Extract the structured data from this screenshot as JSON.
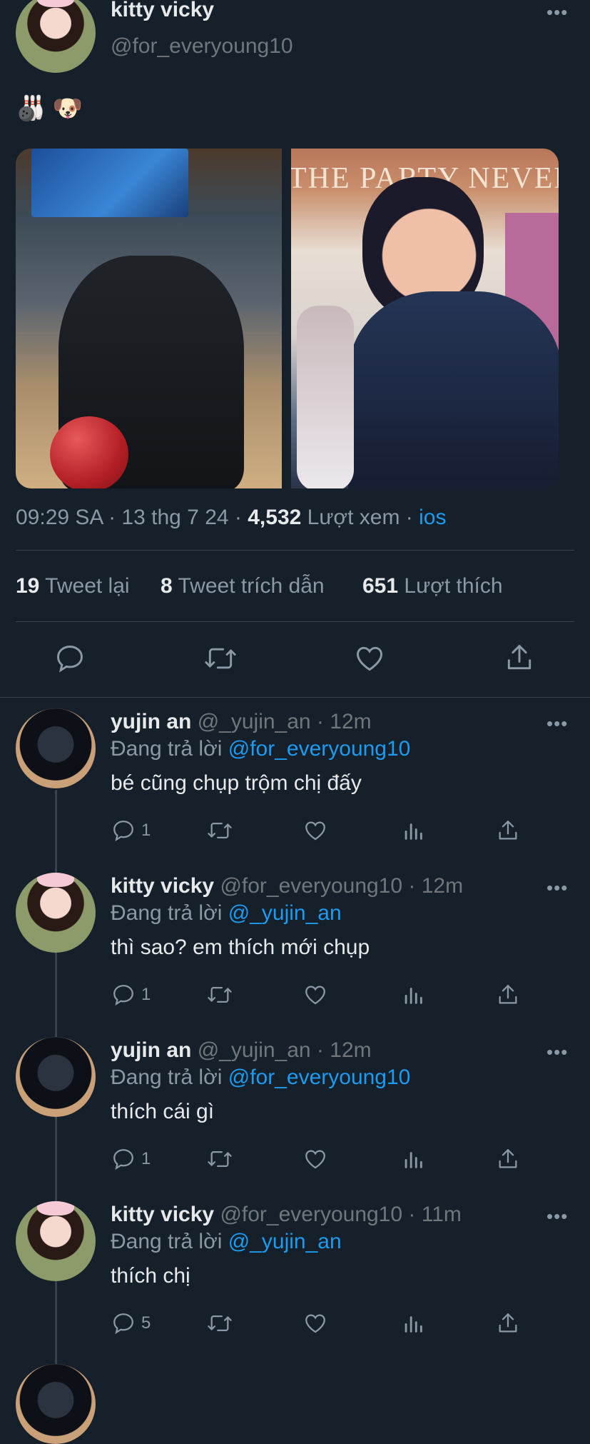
{
  "main_tweet": {
    "author_name": "kitty vicky",
    "author_handle": "@for_everyoung10",
    "text": "🎳 🐶",
    "timestamp": "09:29 SA · 13 thg 7 24 · ",
    "views_count": "4,532",
    "views_label": " Lượt xem · ",
    "source": "ios",
    "retweets_count": "19",
    "retweets_label": "Tweet lại",
    "quotes_count": "8",
    "quotes_label": "Tweet trích dẫn",
    "likes_count": "651",
    "likes_label": "Lượt thích",
    "image_left_sign": "THE PARTY NEVER EN"
  },
  "replies": [
    {
      "name": "yujin an",
      "handle": "@_yujin_an · 12m",
      "replying_prefix": "Đang trả lời ",
      "replying_to": "@for_everyoung10",
      "text": "bé cũng chụp trộm chị đấy",
      "reply_count": "1"
    },
    {
      "name": "kitty vicky",
      "handle": "@for_everyoung10 · 12m",
      "replying_prefix": "Đang trả lời ",
      "replying_to": "@_yujin_an",
      "text": "thì sao? em thích mới chụp",
      "reply_count": "1"
    },
    {
      "name": "yujin an",
      "handle": "@_yujin_an · 12m",
      "replying_prefix": "Đang trả lời ",
      "replying_to": "@for_everyoung10",
      "text": "thích cái gì",
      "reply_count": "1"
    },
    {
      "name": "kitty vicky",
      "handle": "@for_everyoung10 · 11m",
      "replying_prefix": "Đang trả lời ",
      "replying_to": "@_yujin_an",
      "text": "thích chị",
      "reply_count": "5"
    }
  ],
  "icons": [
    "more-icon",
    "reply-icon",
    "retweet-icon",
    "like-icon",
    "share-icon",
    "analytics-icon"
  ],
  "colors": {
    "background": "#15202b",
    "accent": "#1d9bf0",
    "secondary_text": "#8b98a5"
  }
}
